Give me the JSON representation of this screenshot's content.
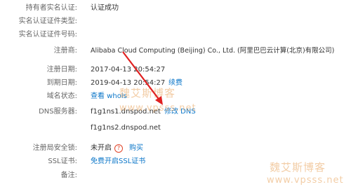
{
  "rows": [
    {
      "label": "持有者实名认证:",
      "value": "认证成功"
    },
    {
      "label": "实名认证证件类型:",
      "value": ""
    },
    {
      "label": "实名认证证件号码:",
      "value": ""
    },
    {
      "label": "注册商:",
      "value": "Alibaba Cloud Computing (Beijing) Co., Ltd. (阿里巴巴云计算(北京)有限公司)"
    },
    {
      "label": "注册日期:",
      "value": "2017-04-13 20:54:27"
    },
    {
      "label": "到期日期:",
      "value": "2019-04-13 20:54:27",
      "link": "续费"
    },
    {
      "label": "域名状态:",
      "link": "查看 whois"
    },
    {
      "label": "DNS服务器:",
      "value": "f1g1ns1.dnspod.net",
      "link": "修改 DNS"
    },
    {
      "label": "",
      "value": "f1g1ns2.dnspod.net"
    },
    {
      "label": "注册局安全锁:",
      "value": "未开启",
      "link": "购买"
    },
    {
      "label": "SSL证书:",
      "link": "免费开启SSL证书"
    },
    {
      "label": "备注:",
      "value": ""
    }
  ],
  "watermark": {
    "cn": "魏艾斯博客",
    "url": "www.vpsss.net"
  },
  "colors": {
    "link": "#0b76c8",
    "warning": "#e0452a",
    "arrow": "#e02020"
  },
  "icons": {
    "lock_warning": "warning-circle-icon"
  }
}
